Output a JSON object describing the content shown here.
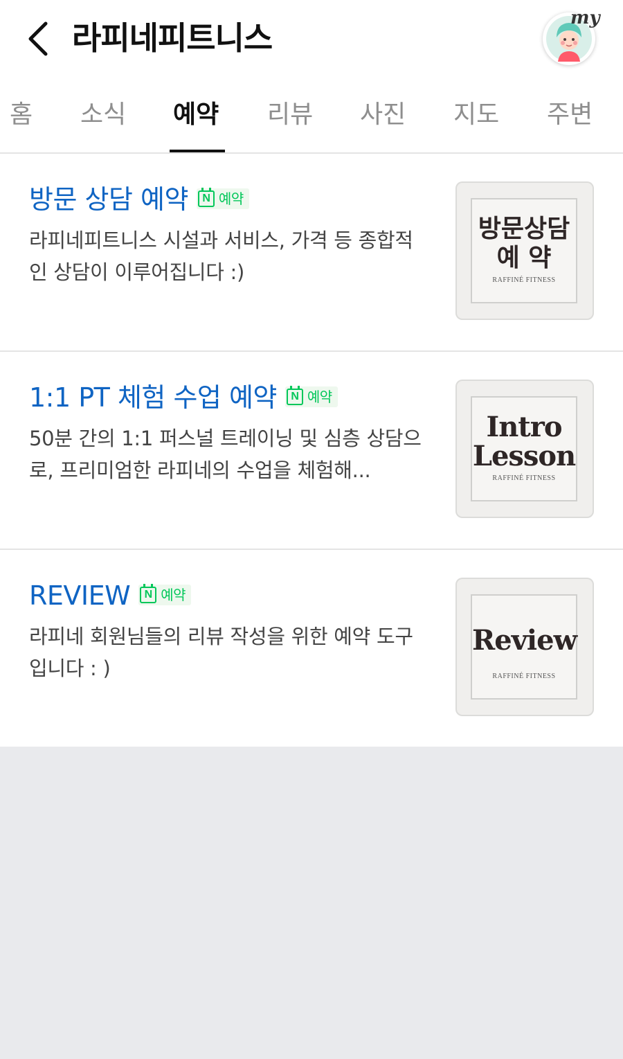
{
  "header": {
    "title": "라피네피트니스",
    "back_icon": "chevron-left-icon",
    "avatar_label": "my"
  },
  "tabs": [
    {
      "label": "홈",
      "active": false
    },
    {
      "label": "소식",
      "active": false
    },
    {
      "label": "예약",
      "active": true
    },
    {
      "label": "리뷰",
      "active": false
    },
    {
      "label": "사진",
      "active": false
    },
    {
      "label": "지도",
      "active": false
    },
    {
      "label": "주변",
      "active": false
    }
  ],
  "items": [
    {
      "title": "방문 상담 예약",
      "badge_letter": "N",
      "badge": "예약",
      "description": "라피네피트니스 시설과 서비스, 가격 등 종합적인 상담이 이루어집니다 :)",
      "thumb_line1": "방문상담",
      "thumb_line2": "예 약",
      "thumb_sub": "RAFFINÉ FITNESS"
    },
    {
      "title": "1:1 PT 체험 수업 예약",
      "badge_letter": "N",
      "badge": "예약",
      "description": "50분 간의 1:1 퍼스널 트레이닝 및 심층 상담으로, 프리미엄한 라피네의 수업을 체험해...",
      "thumb_line1": "Intro",
      "thumb_line2": "Lesson",
      "thumb_sub": "RAFFINÉ FITNESS"
    },
    {
      "title": "REVIEW",
      "badge_letter": "N",
      "badge": "예약",
      "description": "라피네 회원님들의 리뷰 작성을 위한 예약 도구입니다 : )",
      "thumb_line1": "Review",
      "thumb_line2": "",
      "thumb_sub": "RAFFINÉ FITNESS"
    }
  ],
  "colors": {
    "title_blue": "#0f64c3",
    "naver_green": "#03c75a",
    "page_bg": "#e9eaed"
  }
}
